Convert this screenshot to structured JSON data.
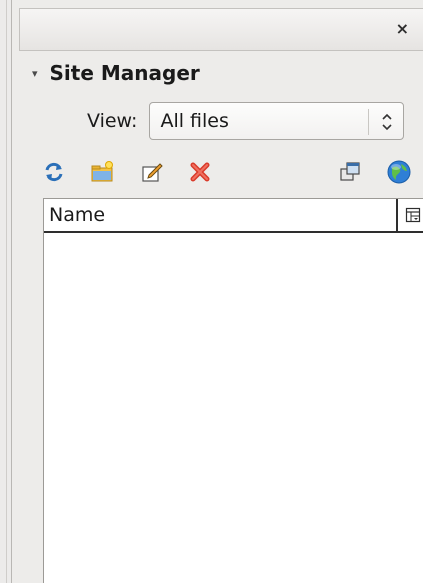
{
  "panel": {
    "close_glyph": "×",
    "expander_glyph": "▾",
    "title": "Site Manager"
  },
  "view": {
    "label": "View:",
    "selected": "All files",
    "arrow_glyph": "⌃⌄"
  },
  "toolbar": {
    "buttons": [
      {
        "icon": "refresh-icon"
      },
      {
        "icon": "new-folder-icon"
      },
      {
        "icon": "rename-icon"
      },
      {
        "icon": "delete-icon"
      },
      {
        "icon": "windows-icon"
      },
      {
        "icon": "globe-icon"
      }
    ]
  },
  "list": {
    "columns": [
      "Name"
    ],
    "rows": []
  },
  "colors": {
    "background": "#edecea",
    "delete": "#d93a2a",
    "globe": "#2f7fd6",
    "refresh": "#2a6fb8",
    "folder": "#f4c245"
  }
}
